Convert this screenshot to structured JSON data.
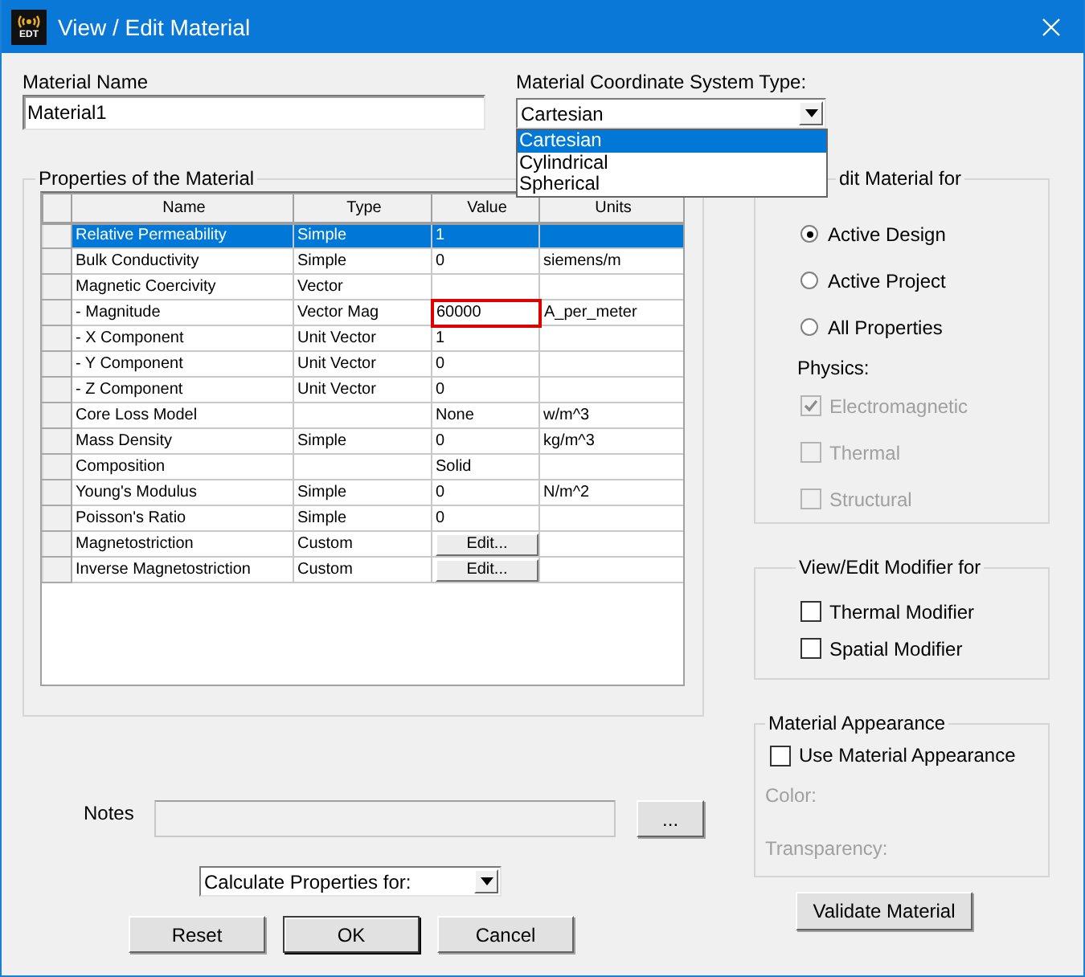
{
  "window": {
    "title": "View / Edit Material",
    "icon_label": "EDT"
  },
  "material_name": {
    "label": "Material Name",
    "value": "Material1"
  },
  "coordinate_system": {
    "label": "Material Coordinate System Type:",
    "value": "Cartesian",
    "expanded": true,
    "options": [
      {
        "label": "Cartesian",
        "selected": true
      },
      {
        "label": "Cylindrical",
        "selected": false
      },
      {
        "label": "Spherical",
        "selected": false
      }
    ]
  },
  "properties": {
    "title": "Properties of the Material",
    "columns": [
      "Name",
      "Type",
      "Value",
      "Units"
    ],
    "rows": [
      {
        "name": "Relative Permeability",
        "type": "Simple",
        "value": "1",
        "selected": true,
        "highlighted": false
      },
      {
        "name": "Bulk Conductivity",
        "type": "Simple",
        "value": "0",
        "units": "siemens/m",
        "selected": false,
        "highlighted": false
      },
      {
        "name": "Magnetic Coercivity",
        "type": "Vector",
        "selected": false,
        "highlighted": false
      },
      {
        "name": "-  Magnitude",
        "type": "Vector Mag",
        "value": "60000",
        "units": "A_per_meter",
        "selected": false,
        "highlighted": true
      },
      {
        "name": "- X Component",
        "type": "Unit Vector",
        "value": "1",
        "selected": false,
        "highlighted": false
      },
      {
        "name": "-  Y Component",
        "type": "Unit Vector",
        "value": "0",
        "selected": false,
        "highlighted": false
      },
      {
        "name": "-  Z Component",
        "type": "Unit Vector",
        "value": "0",
        "selected": false,
        "highlighted": false
      },
      {
        "name": "Core Loss Model",
        "value": "None",
        "units": "w/m^3",
        "selected": false,
        "highlighted": false
      },
      {
        "name": "Mass Density",
        "type": "Simple",
        "value": "0",
        "units": "kg/m^3",
        "selected": false,
        "highlighted": false
      },
      {
        "name": "Composition",
        "value": "Solid",
        "selected": false,
        "highlighted": false
      },
      {
        "name": "Young's Modulus",
        "type": "Simple",
        "value": "0",
        "units": "N/m^2",
        "selected": false,
        "highlighted": false
      },
      {
        "name": "Poisson's Ratio",
        "type": "Simple",
        "value": "0",
        "selected": false,
        "highlighted": false
      },
      {
        "name": "Magnetostriction",
        "type": "Custom",
        "value_button": "Edit...",
        "selected": false,
        "highlighted": false
      },
      {
        "name": "Inverse Magnetostriction",
        "type": "Custom",
        "value_button": "Edit...",
        "selected": false,
        "highlighted": false
      }
    ]
  },
  "notes": {
    "label": "Notes",
    "disabled": true,
    "button": "..."
  },
  "calculate": {
    "value": "Calculate Properties for:"
  },
  "buttons": [
    {
      "label": "Reset",
      "default": false
    },
    {
      "label": "OK",
      "default": true
    },
    {
      "label": "Cancel",
      "default": false
    }
  ],
  "edit_for": {
    "title": "dit Material for",
    "options": [
      {
        "label": "Active Design",
        "selected": true
      },
      {
        "label": "Active Project",
        "selected": false
      },
      {
        "label": "All Properties",
        "selected": false
      }
    ],
    "physics_label": "Physics:",
    "physics": [
      {
        "label": "Electromagnetic",
        "checked": true,
        "disabled": true
      },
      {
        "label": "Thermal",
        "checked": false,
        "disabled": true
      },
      {
        "label": "Structural",
        "checked": false,
        "disabled": true
      }
    ]
  },
  "modifiers": {
    "title": "View/Edit Modifier for",
    "options": [
      {
        "label": "Thermal Modifier",
        "checked": false
      },
      {
        "label": "Spatial Modifier",
        "checked": false
      }
    ]
  },
  "appearance": {
    "title": "Material Appearance",
    "checkbox": {
      "label": "Use Material Appearance",
      "checked": false
    },
    "fields": [
      {
        "label": "Color:",
        "disabled": true
      },
      {
        "label": "Transparency:",
        "disabled": true
      }
    ]
  },
  "validate_button": "Validate Material"
}
